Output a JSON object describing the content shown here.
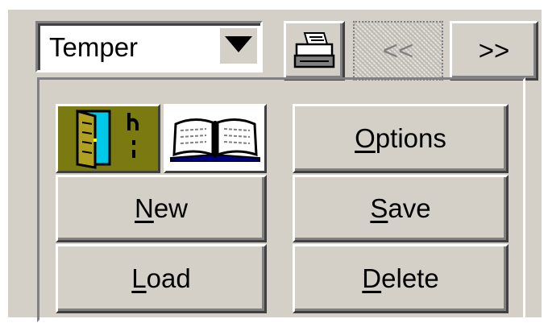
{
  "toolbar": {
    "combo": {
      "value": "Temper",
      "arrow_icon": "triangle-down-icon"
    },
    "print_icon": "printer-icon",
    "prev_label": "<<",
    "next_label": ">>",
    "prev_enabled": false,
    "next_enabled": true
  },
  "group": {
    "icons": [
      {
        "name": "door-exit-icon",
        "description_text": ""
      },
      {
        "name": "open-book-icon"
      }
    ],
    "buttons": {
      "options": {
        "accel": "O",
        "rest": "ptions"
      },
      "new": {
        "accel": "N",
        "rest": "ew"
      },
      "save": {
        "accel": "S",
        "rest": "ave"
      },
      "load": {
        "accel": "L",
        "rest": "oad"
      },
      "delete": {
        "accel": "D",
        "rest": "elete"
      }
    }
  },
  "colors": {
    "face": "#d4d0c8",
    "highlight": "#ffffff",
    "shadow": "#808080",
    "dark_shadow": "#404040",
    "door_panel_bg": "#7a7a10",
    "door_color": "#00c8e8"
  }
}
